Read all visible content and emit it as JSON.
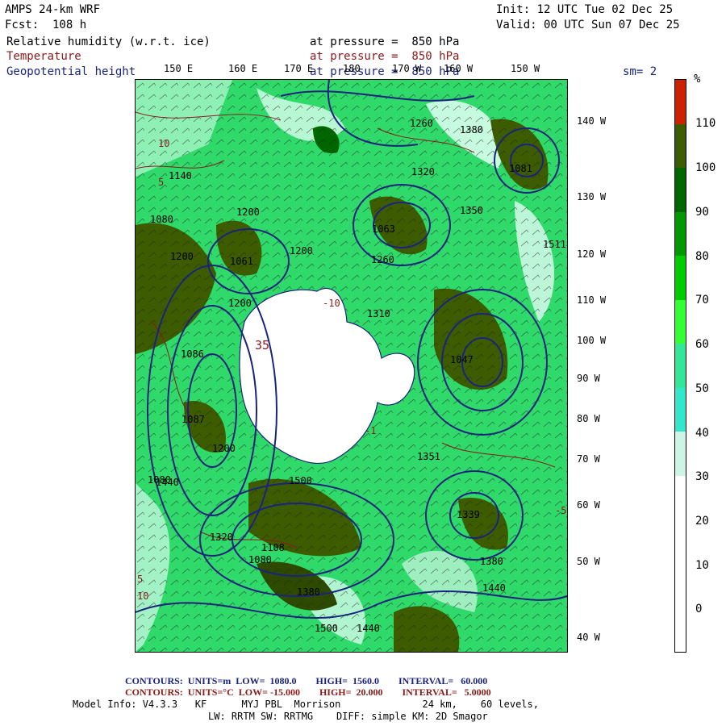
{
  "header": {
    "model": "AMPS 24-km WRF",
    "init": "Init: 12 UTC Tue 02 Dec 25",
    "fcst": "Fcst:  108 h",
    "valid": "Valid: 00 UTC Sun 07 Dec 25",
    "field1": "Relative humidity (w.r.t. ice)",
    "field1_level": "at pressure =  850 hPa",
    "field2": "Temperature",
    "field2_level": "at pressure =  850 hPa",
    "field3": "Geopotential height",
    "field3_level": "at pressure =  850 hPa",
    "smooth": "sm= 2"
  },
  "colors": {
    "rh_title": "#000000",
    "temp": "#8b1a1a",
    "height": "#1a237e"
  },
  "top_longitudes": [
    "150 E",
    "160 E",
    "170 E",
    "180",
    "170 W",
    "160 W",
    "150 W"
  ],
  "right_longitudes": [
    "140 W",
    "130 W",
    "120 W",
    "110 W",
    "100 W",
    "90 W",
    "80 W",
    "70 W",
    "60 W",
    "50 W",
    "40 W"
  ],
  "map_labels": {
    "heights": [
      "1500",
      "1260",
      "1200",
      "1080",
      "1200",
      "1200",
      "1320",
      "1350",
      "1260",
      "1140",
      "1080",
      "1500",
      "1440",
      "1320",
      "1380",
      "1380",
      "1440",
      "1200",
      "1380",
      "1440",
      "1080",
      "1200"
    ],
    "height_centers": [
      "1063",
      "1061",
      "1081",
      "1086",
      "1087",
      "1047",
      "1108",
      "1310",
      "1351",
      "1339",
      "1511"
    ],
    "temps": [
      "35",
      "10",
      "5",
      "10",
      "5",
      "-10",
      "-5",
      "-1"
    ]
  },
  "legend": {
    "unit": "%",
    "ticks": [
      "110",
      "100",
      "90",
      "80",
      "70",
      "60",
      "50",
      "40",
      "30",
      "20",
      "10",
      "0"
    ],
    "colors": [
      "#ffffff",
      "#ffffff",
      "#ffffff",
      "#ccf5e6",
      "#33e6b3",
      "#33ff99",
      "#00ff00",
      "#00cc00",
      "#009900",
      "#006600",
      "#3d5c00",
      "#cc2200"
    ]
  },
  "footer": {
    "contours_height": "CONTOURS:  UNITS=m  LOW=  1080.0        HIGH=  1560.0        INTERVAL=   60.000",
    "contours_temp": "CONTOURS:  UNITS=°C  LOW= -15.000        HIGH=  20.000        INTERVAL=   5.0000",
    "model_info": "Model Info: V4.3.3   KF      MYJ PBL  Morrison              24 km,    60 levels,",
    "physics": "LW: RRTM SW: RRTMG    DIFF: simple KM: 2D Smagor"
  }
}
